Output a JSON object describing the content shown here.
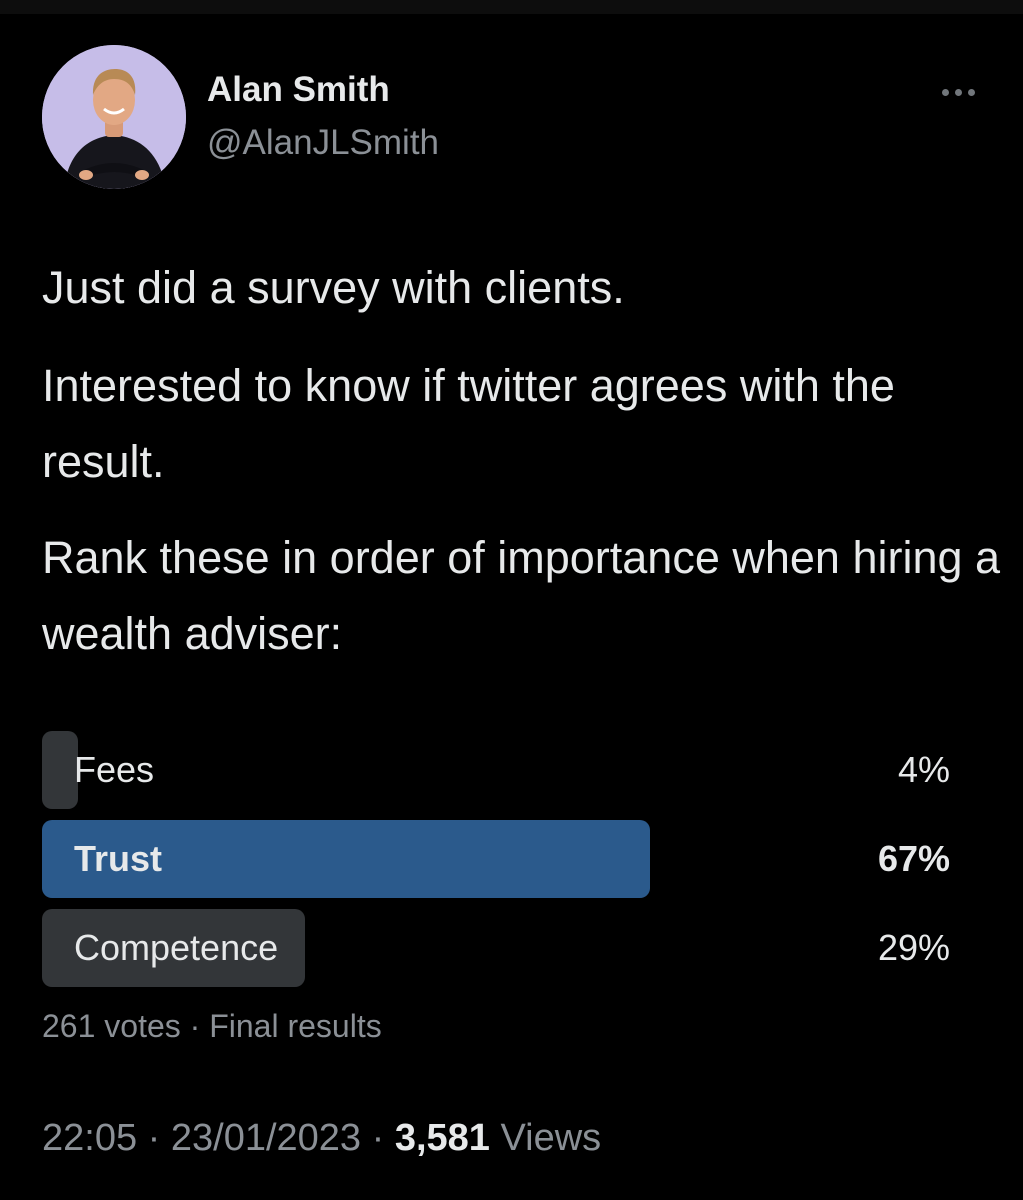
{
  "author": {
    "name": "Alan Smith",
    "handle": "@AlanJLSmith",
    "avatar_icon": "profile-photo"
  },
  "more_icon": "more-options-icon",
  "tweet": {
    "paragraphs": [
      "Just did a survey with clients.",
      "Interested to know if twitter agrees with the result.",
      "Rank these in order of importance when hiring a wealth adviser:"
    ]
  },
  "poll": {
    "options": [
      {
        "label": "Fees",
        "percent_label": "4%",
        "percent": 4,
        "winner": false
      },
      {
        "label": "Trust",
        "percent_label": "67%",
        "percent": 67,
        "winner": true
      },
      {
        "label": "Competence",
        "percent_label": "29%",
        "percent": 29,
        "winner": false
      }
    ],
    "votes": "261 votes",
    "separator": " · ",
    "status": "Final results"
  },
  "meta": {
    "time": "22:05",
    "separator": " · ",
    "date": "23/01/2023",
    "views_count": "3,581",
    "views_label": " Views"
  },
  "colors": {
    "background": "#000000",
    "text": "#e7e9ea",
    "muted": "#8b9096",
    "poll_bar": "#333639",
    "poll_winner": "#2b5a8c",
    "avatar_bg": "#c6bde8"
  }
}
